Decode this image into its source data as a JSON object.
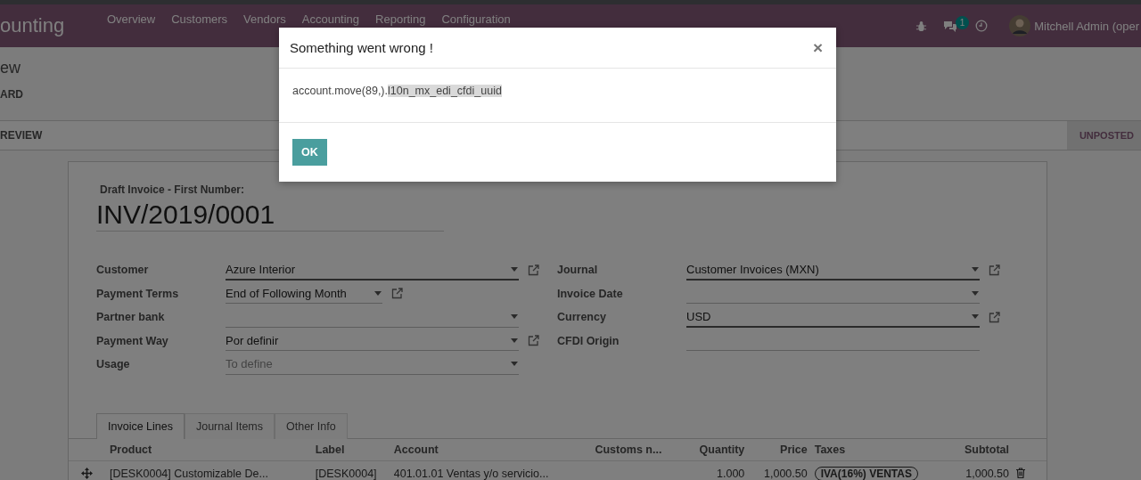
{
  "navbar": {
    "app_title": "ounting",
    "menu": [
      "Overview",
      "Customers",
      "Vendors",
      "Accounting",
      "Reporting",
      "Configuration"
    ],
    "messages_badge": "1",
    "user_name": "Mitchell Admin (oper"
  },
  "breadcrumb": {
    "title": "ew",
    "button": "ARD"
  },
  "status_bar": {
    "action_button": "REVIEW",
    "stages": [
      {
        "label": "UNPOSTED",
        "selected": true
      }
    ]
  },
  "form": {
    "subtitle": "Draft Invoice  - First Number:",
    "name": "INV/2019/0001",
    "left_fields": [
      {
        "label": "Customer",
        "value": "Azure Interior",
        "required": true,
        "compact": false,
        "external_link": true
      },
      {
        "label": "Payment Terms",
        "value": "End of Following Month",
        "required": false,
        "compact": true,
        "external_link": true
      },
      {
        "label": "Partner bank",
        "required": false,
        "compact": false,
        "external_link": false
      },
      {
        "label": "Payment Way",
        "value": "Por definir",
        "required": false,
        "compact": false,
        "external_link": true
      },
      {
        "label": "Usage",
        "placeholder": "To define",
        "required": false,
        "compact": false,
        "external_link": false
      }
    ],
    "right_fields": [
      {
        "label": "Journal",
        "value": "Customer Invoices (MXN)",
        "required": true,
        "compact": false,
        "external_link": true
      },
      {
        "label": "Invoice Date",
        "required": false,
        "compact": false,
        "external_link": false
      },
      {
        "label": "Currency",
        "value": "USD",
        "required": true,
        "compact": false,
        "external_link": true
      },
      {
        "label": "CFDI Origin",
        "required": false,
        "compact": false,
        "external_link": false,
        "kind": "text"
      }
    ],
    "tabs": [
      {
        "label": "Invoice Lines",
        "selected": true
      },
      {
        "label": "Journal Items",
        "selected": false
      },
      {
        "label": "Other Info",
        "selected": false
      }
    ],
    "table": {
      "columns": [
        "Product",
        "Label",
        "Account",
        "Customs n...",
        "Quantity",
        "Price",
        "Taxes",
        "Subtotal"
      ],
      "rows": [
        {
          "product": "[DESK0004] Customizable De...",
          "label": "[DESK0004]",
          "account": "401.01.01 Ventas y/o servicio...",
          "quantity": "1.000",
          "price": "1,000.50",
          "taxes": [
            "IVA(16%) VENTAS"
          ],
          "subtotal": "1,000.50"
        }
      ]
    }
  },
  "dialog": {
    "title": "Something went wrong !",
    "close": "×",
    "message": "account.move(89,).",
    "message_selected": "l10n_mx_edi_cfdi_uuid",
    "button": "OK"
  }
}
